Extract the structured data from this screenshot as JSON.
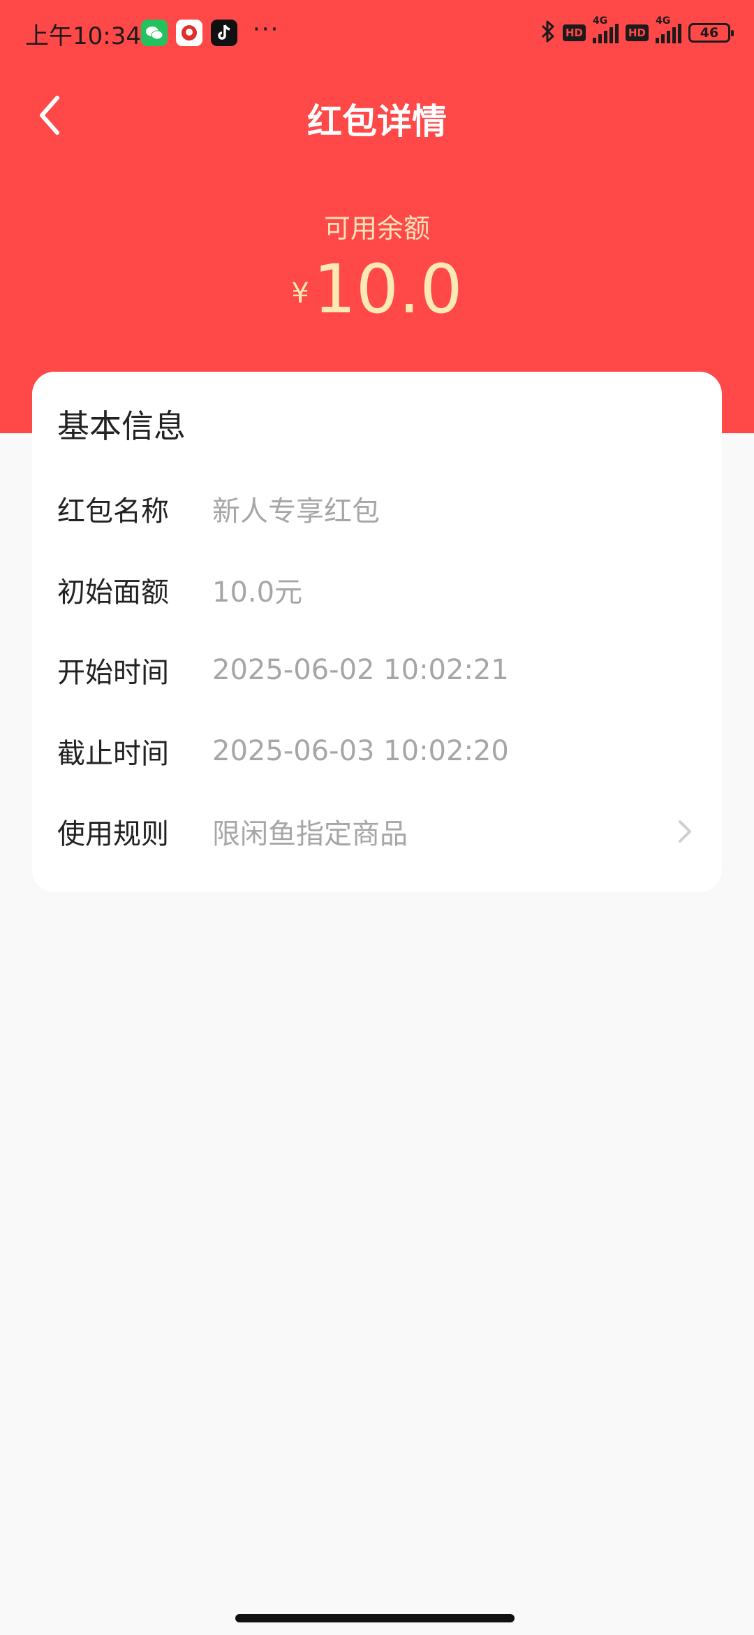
{
  "status_bar": {
    "time": "上午10:34",
    "network_1": "4G",
    "network_2": "4G",
    "hd_1": "HD",
    "hd_2": "HD",
    "battery": "46",
    "apps": [
      "wechat-icon",
      "xianyu-icon",
      "tiktok-icon"
    ],
    "more": "···"
  },
  "header": {
    "title": "红包详情"
  },
  "balance": {
    "label": "可用余额",
    "currency": "¥",
    "amount": "10.0"
  },
  "card": {
    "title": "基本信息",
    "rows": [
      {
        "label": "红包名称",
        "value": "新人专享红包"
      },
      {
        "label": "初始面额",
        "value": "10.0元"
      },
      {
        "label": "开始时间",
        "value": "2025-06-02 10:02:21"
      },
      {
        "label": "截止时间",
        "value": "2025-06-03 10:02:20"
      },
      {
        "label": "使用规则",
        "value": "限闲鱼指定商品"
      }
    ]
  },
  "colors": {
    "header_red": "#ff4848",
    "balance_gold": "#fde9b6",
    "page_bg": "#f9f9f9",
    "value_gray": "#a6a6a6"
  }
}
